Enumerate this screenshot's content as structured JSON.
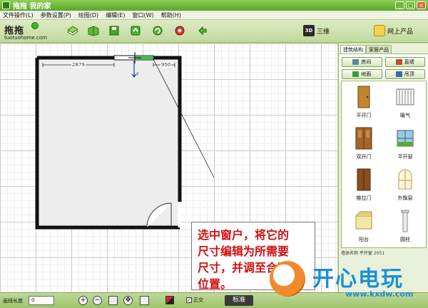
{
  "window": {
    "title": "拖拖 我的家"
  },
  "menu": [
    "文件操作(L)",
    "参数设置(P)",
    "绘图(D)",
    "编辑(E)",
    "窗口(W)",
    "帮助(H)"
  ],
  "logo": {
    "text": "拖拖",
    "url": "tuotuohome.com"
  },
  "toolbar": {
    "view3d_badge": "3D",
    "view3d_label": "三维",
    "shop_label": "网上产品"
  },
  "plan": {
    "dim_left": "2879",
    "dim_right": "950",
    "y_axis": "Y"
  },
  "callout": {
    "lines": [
      "选中窗户，将它的",
      "尺寸编辑为所需要",
      "尺寸，并调至合适",
      "位置。"
    ]
  },
  "panel": {
    "tabs": [
      "建筑结构",
      "家居产品"
    ],
    "categories": [
      "房间",
      "直墙",
      "地面",
      "吊顶"
    ],
    "items": [
      "平开门",
      "暖气",
      "双开门",
      "平开窗",
      "推拉门",
      "外飘窗",
      "阳台",
      "圆柱"
    ],
    "bottom_text": "墙体名称    平开窗     2051"
  },
  "status": {
    "length_label": "画线长度",
    "length_value": "0",
    "ortho_label": "正交",
    "standard_label": "标准"
  },
  "watermark": {
    "brand": "开心电玩",
    "site": "www.kxdw.com"
  },
  "colors": {
    "title_bar": "#5aa52a",
    "callout_text": "#d11010",
    "watermark": "#1a8fd8"
  }
}
